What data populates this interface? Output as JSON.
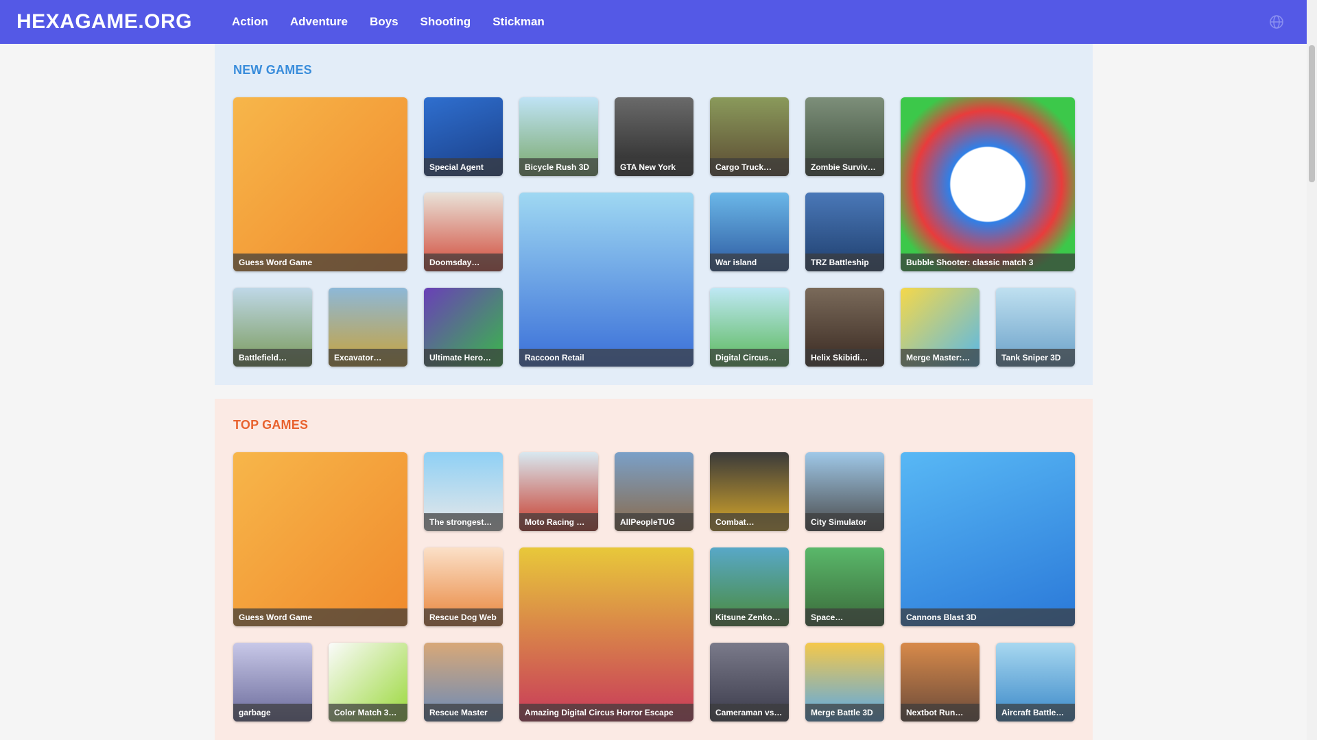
{
  "header": {
    "logo": "HEXAGAME.ORG",
    "nav": [
      "Action",
      "Adventure",
      "Boys",
      "Shooting",
      "Stickman"
    ]
  },
  "colors": {
    "header_bg": "#5459e6",
    "new_section_bg": "#e3edf8",
    "top_section_bg": "#fbeae4",
    "new_title": "#3a8ddb",
    "top_title": "#e8622e"
  },
  "new_games": {
    "title": "NEW GAMES",
    "items": [
      {
        "label": "Guess Word Game",
        "big": true,
        "bg": "linear-gradient(135deg,#f7b64a,#f08a2c)"
      },
      {
        "label": "Special Agent",
        "big": false,
        "bg": "linear-gradient(160deg,#2f6fcf,#1a3e86)"
      },
      {
        "label": "Bicycle Rush 3D",
        "big": false,
        "bg": "linear-gradient(180deg,#bfe3f5,#7aa86b)"
      },
      {
        "label": "GTA New York",
        "big": false,
        "bg": "linear-gradient(180deg,#6a6a6a,#2a2a2a)"
      },
      {
        "label": "Cargo Truck…",
        "big": false,
        "bg": "linear-gradient(180deg,#8a9a5b,#5b4a32)"
      },
      {
        "label": "Zombie Surviv…",
        "big": false,
        "bg": "linear-gradient(180deg,#7d8f7a,#3a4a38)"
      },
      {
        "label": "Bubble Shooter: classic match 3",
        "big": true,
        "bg": "radial-gradient(circle at 50% 50%,#ffffff 30%,#2f80e8 31%,#e83c3c 60%,#3cc84a 80%)"
      },
      {
        "label": "Doomsday…",
        "big": false,
        "bg": "linear-gradient(180deg,#e9e2d8,#d14a3a)"
      },
      {
        "label": "Raccoon Retail",
        "big": true,
        "bg": "linear-gradient(180deg,#9fd8f2,#3a6fd8)"
      },
      {
        "label": "War island",
        "big": false,
        "bg": "linear-gradient(180deg,#6bb7e8,#2d5aa0)"
      },
      {
        "label": "TRZ Battleship",
        "big": false,
        "bg": "linear-gradient(180deg,#4a78b8,#1f3f6e)"
      },
      {
        "label": "Battlefield…",
        "big": false,
        "bg": "linear-gradient(180deg,#bfd8e8,#7a9a5a)"
      },
      {
        "label": "Excavator…",
        "big": false,
        "bg": "linear-gradient(180deg,#8db8d8,#c9a23a)"
      },
      {
        "label": "Ultimate Hero…",
        "big": false,
        "bg": "linear-gradient(135deg,#6a3fb8,#3ab84a)"
      },
      {
        "label": "Digital Circus…",
        "big": false,
        "bg": "linear-gradient(180deg,#bfe8f5,#5ab85a)"
      },
      {
        "label": "Helix Skibidi…",
        "big": false,
        "bg": "linear-gradient(180deg,#7a6a5a,#3a2a22)"
      },
      {
        "label": "Merge Master:…",
        "big": false,
        "bg": "linear-gradient(135deg,#f5d84a,#58b8e8)"
      },
      {
        "label": "Tank Sniper 3D",
        "big": false,
        "bg": "linear-gradient(180deg,#bfe0f0,#6aa0c8)"
      }
    ]
  },
  "top_games": {
    "title": "TOP GAMES",
    "items": [
      {
        "label": "Guess Word Game",
        "big": true,
        "bg": "linear-gradient(135deg,#f7b64a,#f08a2c)"
      },
      {
        "label": "The strongest…",
        "big": false,
        "bg": "linear-gradient(180deg,#8fd0f5,#e8e8e8)"
      },
      {
        "label": "Moto Racing …",
        "big": false,
        "bg": "linear-gradient(180deg,#d8e8f0,#c83a2a)"
      },
      {
        "label": "AllPeopleTUG",
        "big": false,
        "bg": "linear-gradient(180deg,#7aa0c8,#8a6a4a)"
      },
      {
        "label": "Combat…",
        "big": false,
        "bg": "linear-gradient(180deg,#3a3a3a,#d8a82a)"
      },
      {
        "label": "City Simulator",
        "big": false,
        "bg": "linear-gradient(180deg,#9fc8e8,#4a4a4a)"
      },
      {
        "label": "Cannons Blast 3D",
        "big": true,
        "bg": "linear-gradient(160deg,#58b8f5,#2a78d8)"
      },
      {
        "label": "Rescue Dog Web",
        "big": false,
        "bg": "linear-gradient(180deg,#fbe0c8,#e8843a)"
      },
      {
        "label": "Amazing Digital Circus Horror Escape",
        "big": true,
        "bg": "linear-gradient(180deg,#e8c83a,#c83a5a)"
      },
      {
        "label": "Kitsune Zenko…",
        "big": false,
        "bg": "linear-gradient(180deg,#58a8c8,#4a8a3a)"
      },
      {
        "label": "Space…",
        "big": false,
        "bg": "linear-gradient(180deg,#5ab86a,#3a6a3a)"
      },
      {
        "label": "garbage",
        "big": false,
        "bg": "linear-gradient(180deg,#c8c8e8,#6a6a9a)"
      },
      {
        "label": "Color Match 3…",
        "big": false,
        "bg": "linear-gradient(135deg,#fbfbfb,#9ad83a)"
      },
      {
        "label": "Rescue Master",
        "big": false,
        "bg": "linear-gradient(180deg,#d8a878,#6a8ab8)"
      },
      {
        "label": "Cameraman vs…",
        "big": false,
        "bg": "linear-gradient(180deg,#7a7a8a,#3a3a4a)"
      },
      {
        "label": "Merge Battle 3D",
        "big": false,
        "bg": "linear-gradient(180deg,#f5c84a,#58a8e8)"
      },
      {
        "label": "Nextbot Run…",
        "big": false,
        "bg": "linear-gradient(180deg,#d88a4a,#6a4a3a)"
      },
      {
        "label": "Aircraft Battle…",
        "big": false,
        "bg": "linear-gradient(180deg,#a8d8f0,#3a88c8)"
      }
    ]
  }
}
